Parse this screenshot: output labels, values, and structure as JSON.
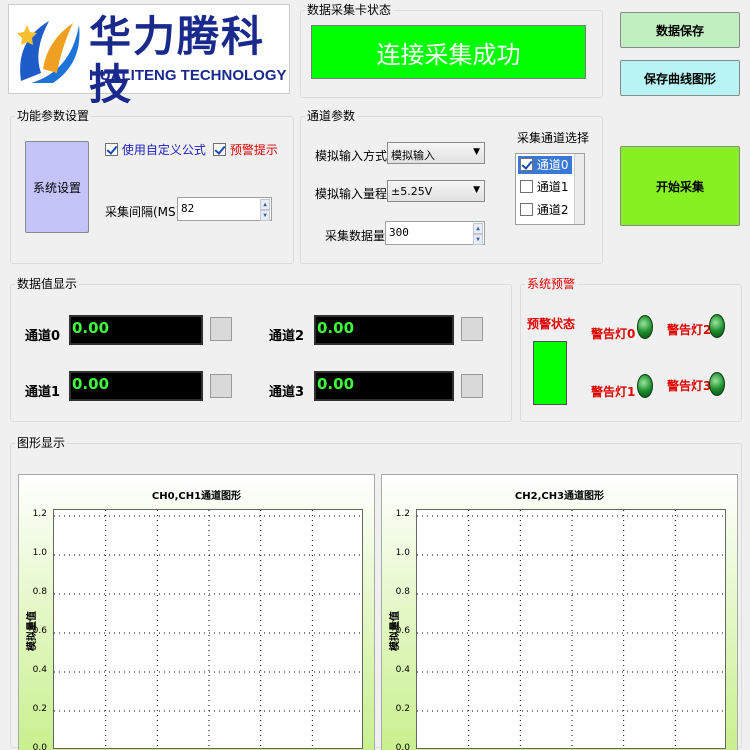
{
  "logo": {
    "cn_text": "华力腾科技",
    "en_text": "HUALITENG TECHNOLOGY"
  },
  "daq_status": {
    "group_title": "数据采集卡状态",
    "message": "连接采集成功",
    "color": "#00ff00"
  },
  "buttons": {
    "save_data": "数据保存",
    "save_curve": "保存曲线图形",
    "start": "开始采集",
    "system_settings": "系统设置"
  },
  "function_settings": {
    "group_title": "功能参数设置",
    "custom_formula_label": "使用自定义公式",
    "custom_formula_checked": true,
    "alarm_prompt_label": "预警提示",
    "alarm_prompt_checked": true,
    "interval_label": "采集间隔(MS)",
    "interval_value": "82"
  },
  "channel_params": {
    "group_title": "通道参数",
    "input_mode_label": "模拟输入方式",
    "input_mode_value": "模拟输入",
    "input_range_label": "模拟输入量程",
    "input_range_value": "±5.25V",
    "sample_count_label": "采集数据量",
    "sample_count_value": "300",
    "channel_select_title": "采集通道选择",
    "channels": [
      {
        "label": "通道0",
        "checked": true
      },
      {
        "label": "通道1",
        "checked": false
      },
      {
        "label": "通道2",
        "checked": false
      }
    ]
  },
  "data_display": {
    "group_title": "数据值显示",
    "channels": [
      {
        "label": "通道0",
        "value": "0.00"
      },
      {
        "label": "通道1",
        "value": "0.00"
      },
      {
        "label": "通道2",
        "value": "0.00"
      },
      {
        "label": "通道3",
        "value": "0.00"
      }
    ]
  },
  "alarm": {
    "group_title": "系统预警",
    "status_label": "预警状态",
    "status_color": "#00ff00",
    "lights": [
      {
        "label": "警告灯0"
      },
      {
        "label": "警告灯1"
      },
      {
        "label": "警告灯2"
      },
      {
        "label": "警告灯3"
      }
    ]
  },
  "graph": {
    "group_title": "图形显示"
  },
  "chart_data": [
    {
      "type": "line",
      "title": "CH0,CH1通道图形",
      "ylabel": "模拟量值",
      "ylim": [
        0.0,
        1.2
      ],
      "y_ticks": [
        "1.2",
        "1.0",
        "0.8",
        "0.6",
        "0.4",
        "0.2",
        "0.0"
      ],
      "grid": true,
      "series": []
    },
    {
      "type": "line",
      "title": "CH2,CH3通道图形",
      "ylabel": "模拟量值",
      "ylim": [
        0.0,
        1.2
      ],
      "y_ticks": [
        "1.2",
        "1.0",
        "0.8",
        "0.6",
        "0.4",
        "0.2",
        "0.0"
      ],
      "grid": true,
      "series": []
    }
  ]
}
